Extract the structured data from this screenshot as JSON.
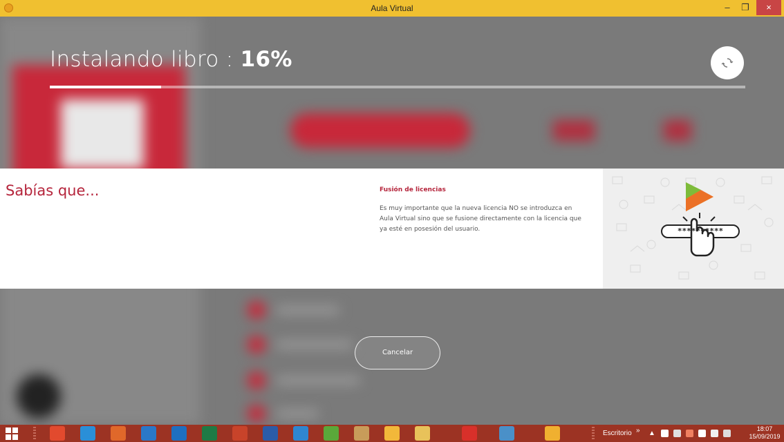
{
  "window": {
    "title": "Aula Virtual",
    "minimize_glyph": "–",
    "maximize_glyph": "❐",
    "close_glyph": "×"
  },
  "install": {
    "label": "Instalando libro : ",
    "percent_text": "16%",
    "progress": 0.16
  },
  "info": {
    "heading": "Sabías que...",
    "tip_title": "Fusión de licencias",
    "tip_body": "Es muy importante que la nueva licencia NO se introduzca en Aula Virtual sino que se fusione directamente con la licencia que ya esté en posesión del usuario.",
    "illustration_password": "**********"
  },
  "cancel_label": "Cancelar",
  "taskbar": {
    "apps": [
      {
        "icon": "chrome-icon",
        "color": "#e24a2e"
      },
      {
        "icon": "internet-explorer-icon",
        "color": "#2a8fd8"
      },
      {
        "icon": "firefox-icon",
        "color": "#e0682a"
      },
      {
        "icon": "media-player-icon",
        "color": "#2a78c8"
      },
      {
        "icon": "outlook-icon",
        "color": "#1e6fc0"
      },
      {
        "icon": "excel-icon",
        "color": "#1f7a45"
      },
      {
        "icon": "powerpoint-icon",
        "color": "#c8432a"
      },
      {
        "icon": "word-icon",
        "color": "#2b5ca8"
      },
      {
        "icon": "onedrive-icon",
        "color": "#2f86d0"
      },
      {
        "icon": "utorrent-icon",
        "color": "#5aa83a"
      },
      {
        "icon": "paint-icon",
        "color": "#c89c5a"
      },
      {
        "icon": "google-drive-icon",
        "color": "#f2b83a"
      },
      {
        "icon": "file-explorer-icon",
        "color": "#e8c25a"
      },
      {
        "icon": "acrobat-reader-icon",
        "color": "#d8302a"
      },
      {
        "icon": "network-app-icon",
        "color": "#4a90c8"
      },
      {
        "icon": "aula-virtual-icon",
        "color": "#f0b030"
      }
    ],
    "desktop_label": "Escritorio",
    "chevron": "»",
    "clock_time": "18:07",
    "clock_date": "15/09/2019"
  },
  "colors": {
    "accent": "#b5243b",
    "titlebar": "#f0c030",
    "taskbar": "#9c3323"
  }
}
